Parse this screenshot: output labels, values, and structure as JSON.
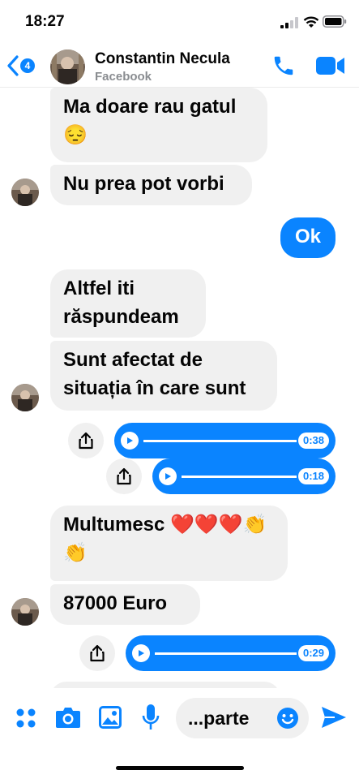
{
  "status": {
    "time": "18:27"
  },
  "header": {
    "back_count": "4",
    "name": "Constantin Necula",
    "subtitle": "Facebook"
  },
  "messages": {
    "m1": "Ma doare rau gatul",
    "m1_emoji": "😔",
    "m2": "Nu prea pot vorbi",
    "m3": "Ok",
    "m4a": "Altfel iti",
    "m4b": "răspundeam",
    "m5a": "Sunt afectat de",
    "m5b": "situația în care sunt",
    "audio1": "0:38",
    "audio2": "0:18",
    "m6a": "Multumesc ❤️❤️❤️👏",
    "m6b": "👏",
    "m7": "87000 Euro",
    "audio3": "0:29"
  },
  "composer": {
    "text": "...parte"
  },
  "colors": {
    "accent": "#0a84ff",
    "bubble_in": "#f0f0f0"
  },
  "icons": [
    "back-chevron-icon",
    "phone-icon",
    "video-camera-icon",
    "share-icon",
    "play-icon",
    "apps-grid-icon",
    "camera-icon",
    "image-icon",
    "microphone-icon",
    "smile-icon",
    "send-icon"
  ]
}
